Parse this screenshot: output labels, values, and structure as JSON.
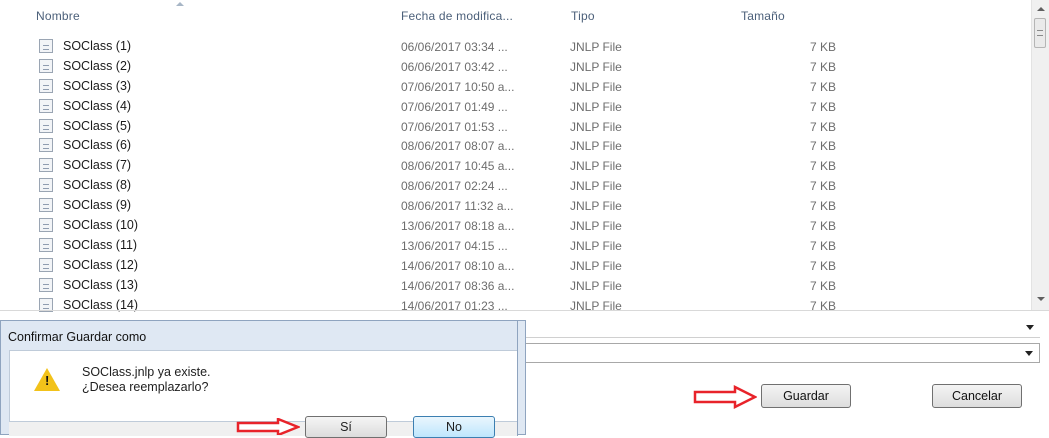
{
  "columns": {
    "name": "Nombre",
    "date": "Fecha de modifica...",
    "type": "Tipo",
    "size": "Tamaño"
  },
  "files": [
    {
      "name": "SOClass (1)",
      "date": "06/06/2017 03:34 ...",
      "type": "JNLP File",
      "size": "7 KB"
    },
    {
      "name": "SOClass (2)",
      "date": "06/06/2017 03:42 ...",
      "type": "JNLP File",
      "size": "7 KB"
    },
    {
      "name": "SOClass (3)",
      "date": "07/06/2017 10:50 a...",
      "type": "JNLP File",
      "size": "7 KB"
    },
    {
      "name": "SOClass (4)",
      "date": "07/06/2017 01:49 ...",
      "type": "JNLP File",
      "size": "7 KB"
    },
    {
      "name": "SOClass (5)",
      "date": "07/06/2017 01:53 ...",
      "type": "JNLP File",
      "size": "7 KB"
    },
    {
      "name": "SOClass (6)",
      "date": "08/06/2017 08:07 a...",
      "type": "JNLP File",
      "size": "7 KB"
    },
    {
      "name": "SOClass (7)",
      "date": "08/06/2017 10:45 a...",
      "type": "JNLP File",
      "size": "7 KB"
    },
    {
      "name": "SOClass (8)",
      "date": "08/06/2017 02:24 ...",
      "type": "JNLP File",
      "size": "7 KB"
    },
    {
      "name": "SOClass (9)",
      "date": "08/06/2017 11:32 a...",
      "type": "JNLP File",
      "size": "7 KB"
    },
    {
      "name": "SOClass (10)",
      "date": "13/06/2017 08:18 a...",
      "type": "JNLP File",
      "size": "7 KB"
    },
    {
      "name": "SOClass (11)",
      "date": "13/06/2017 04:15 ...",
      "type": "JNLP File",
      "size": "7 KB"
    },
    {
      "name": "SOClass (12)",
      "date": "14/06/2017 08:10 a...",
      "type": "JNLP File",
      "size": "7 KB"
    },
    {
      "name": "SOClass (13)",
      "date": "14/06/2017 08:36 a...",
      "type": "JNLP File",
      "size": "7 KB"
    },
    {
      "name": "SOClass (14)",
      "date": "14/06/2017 01:23 ...",
      "type": "JNLP File",
      "size": "7 KB"
    }
  ],
  "buttons": {
    "save": "Guardar",
    "cancel": "Cancelar"
  },
  "confirm_dialog": {
    "title": "Confirmar Guardar como",
    "message_line1": "SOClass.jnlp ya existe.",
    "message_line2": "¿Desea reemplazarlo?",
    "yes": "Sí",
    "no": "No",
    "warning_icon": "warning-icon"
  },
  "colors": {
    "annotation_arrow": "#e8232a",
    "dialog_frame": "#dfe8f3"
  }
}
